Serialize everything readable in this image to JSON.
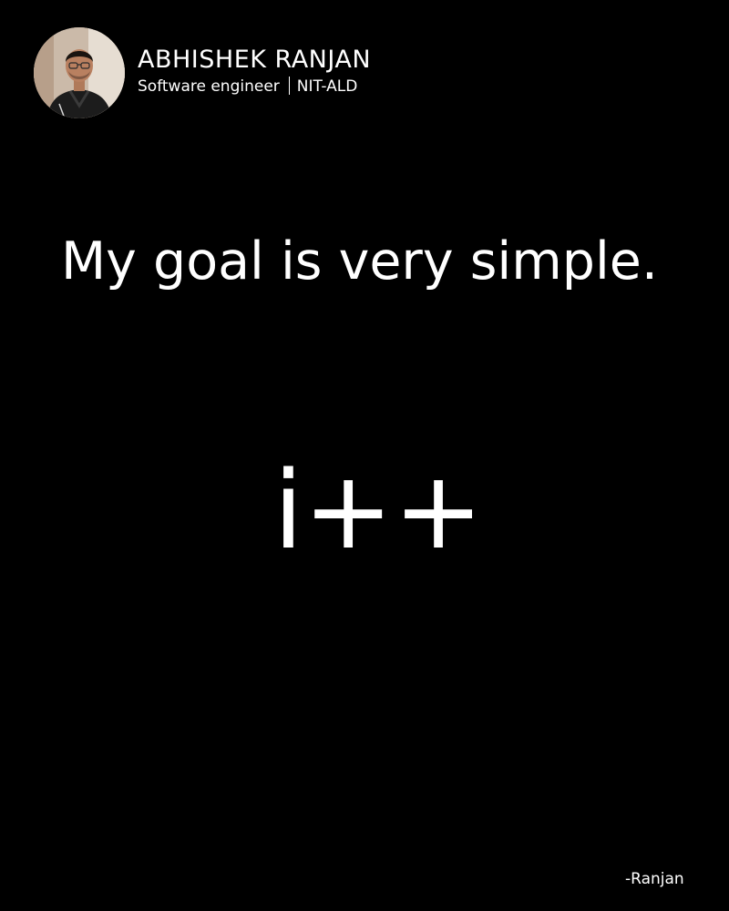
{
  "profile": {
    "name": "ABHISHEK RANJAN",
    "role": "Software engineer",
    "institution": "NIT-ALD",
    "avatar_icon": "person-photo"
  },
  "content": {
    "headline": "My goal is very simple.",
    "code": "i++",
    "signature": "-Ranjan"
  },
  "colors": {
    "background": "#000000",
    "text": "#ffffff"
  }
}
